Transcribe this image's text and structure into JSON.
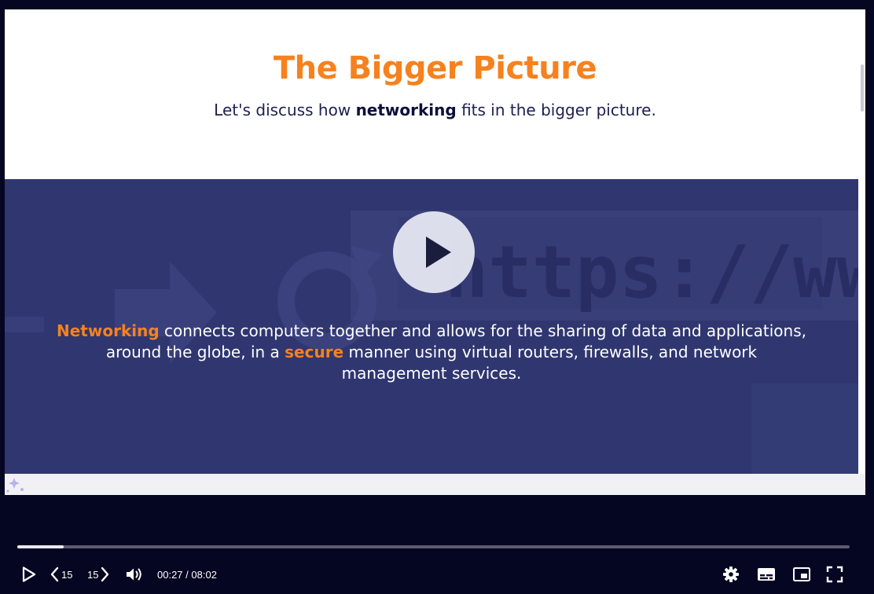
{
  "slide": {
    "title": "The Bigger Picture",
    "subtitle_pre": "Let's discuss how ",
    "subtitle_bold": "networking",
    "subtitle_post": " fits in the bigger picture.",
    "body_hl1": "Networking",
    "body_1": " connects computers together and allows for the sharing of data and applications, around the globe, in a ",
    "body_hl2": "secure",
    "body_2": " manner using virtual routers, firewalls, and network management services.",
    "background_url_text": "https://www."
  },
  "player": {
    "current_time": "00:27",
    "separator": " / ",
    "duration": "08:02",
    "progress": 0.056,
    "skip_back_label": "15",
    "skip_forward_label": "15"
  },
  "colors": {
    "accent": "#f5821f",
    "banner": "#2f3670",
    "player_bg": "#050622"
  },
  "icons": [
    "play-icon",
    "skip-back-icon",
    "skip-forward-icon",
    "volume-icon",
    "settings-icon",
    "captions-icon",
    "picture-in-picture-icon",
    "fullscreen-icon"
  ]
}
